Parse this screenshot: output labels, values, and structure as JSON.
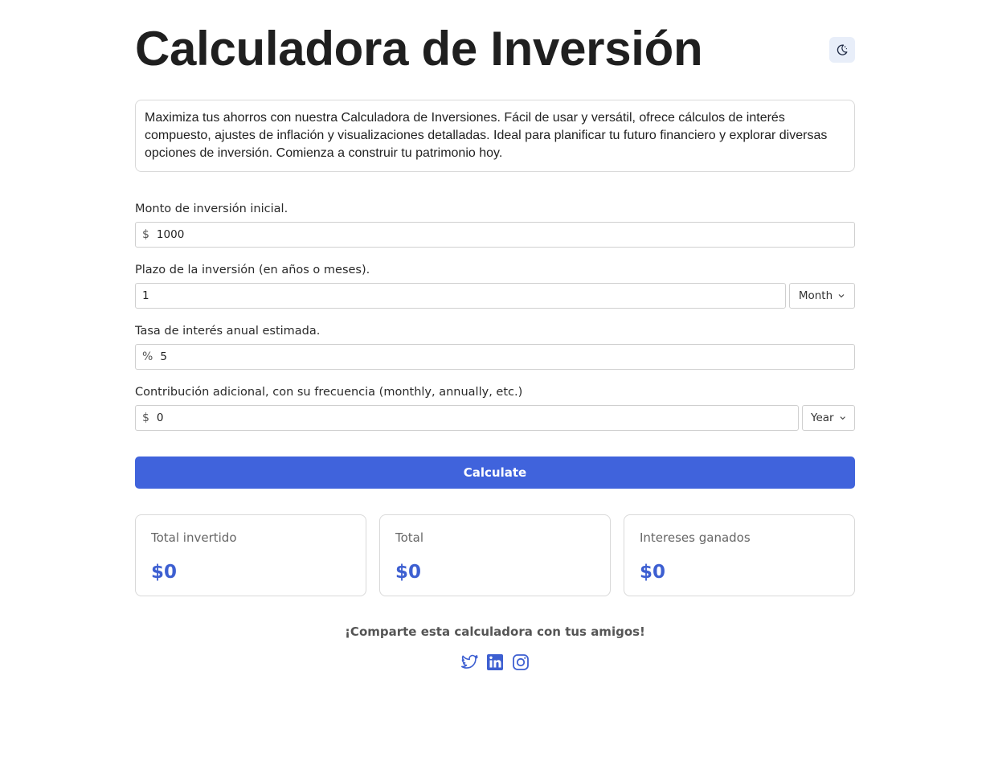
{
  "header": {
    "title": "Calculadora de Inversión"
  },
  "description": "Maximiza tus ahorros con nuestra Calculadora de Inversiones. Fácil de usar y versátil, ofrece cálculos de interés compuesto, ajustes de inflación y visualizaciones detalladas. Ideal para planificar tu futuro financiero y explorar diversas opciones de inversión. Comienza a construir tu patrimonio hoy.",
  "form": {
    "initial": {
      "label": "Monto de inversión inicial.",
      "prefix": "$",
      "value": "1000"
    },
    "term": {
      "label": "Plazo de la inversión (en años o meses).",
      "value": "1",
      "unit": "Month"
    },
    "rate": {
      "label": "Tasa de interés anual estimada.",
      "prefix": "%",
      "value": "5"
    },
    "contribution": {
      "label": "Contribución adicional, con su frecuencia (monthly, annually, etc.)",
      "prefix": "$",
      "value": "0",
      "frequency": "Year"
    },
    "calculate_label": "Calculate"
  },
  "results": [
    {
      "label": "Total invertido",
      "value": "$0"
    },
    {
      "label": "Total",
      "value": "$0"
    },
    {
      "label": "Intereses ganados",
      "value": "$0"
    }
  ],
  "share": {
    "text": "¡Comparte esta calculadora con tus amigos!",
    "icons": [
      "twitter-icon",
      "linkedin-icon",
      "instagram-icon"
    ]
  },
  "colors": {
    "accent": "#4063dc",
    "value_text": "#3d5fd1",
    "theme_button_bg": "#e8eef9"
  }
}
